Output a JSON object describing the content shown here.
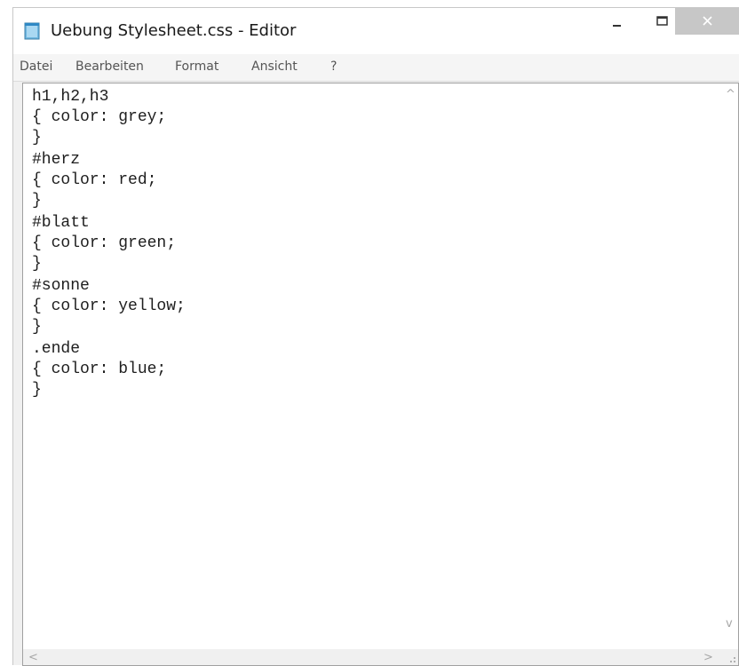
{
  "window": {
    "title": "Uebung Stylesheet.css - Editor",
    "icon": "notepad-icon",
    "controls": {
      "minimize_icon": "minimize-icon",
      "maximize_icon": "maximize-icon",
      "close_icon": "close-icon"
    }
  },
  "menu": {
    "items": [
      {
        "label": "Datei"
      },
      {
        "label": "Bearbeiten"
      },
      {
        "label": "Format"
      },
      {
        "label": "Ansicht"
      },
      {
        "label": "?"
      }
    ]
  },
  "editor": {
    "lines": [
      "h1,h2,h3",
      "{ color: grey;",
      "}",
      "#herz",
      "{ color: red;",
      "}",
      "#blatt",
      "{ color: green;",
      "}",
      "#sonne",
      "{ color: yellow;",
      "}",
      ".ende",
      "{ color: blue;",
      "}"
    ]
  },
  "scrollbars": {
    "up_arrow": "^",
    "down_arrow": "v",
    "left_arrow": "<",
    "right_arrow": ">"
  },
  "colors": {
    "close_button_bg": "#c7c7c7",
    "window_bg": "#f0f0f0",
    "editor_bg": "#ffffff",
    "menu_text": "#555555"
  }
}
